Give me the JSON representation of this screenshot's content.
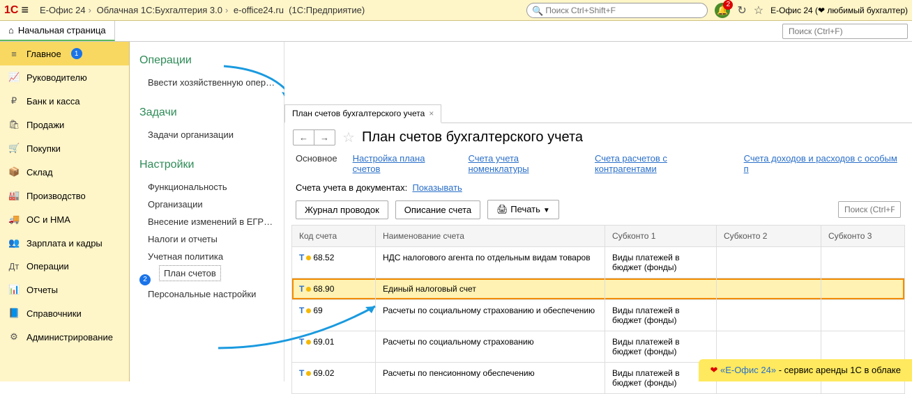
{
  "topbar": {
    "breadcrumb": [
      "Е-Офис 24",
      "Облачная 1С:Бухгалтерия 3.0",
      "e-office24.ru",
      "(1С:Предприятие)"
    ],
    "search_placeholder": "Поиск Ctrl+Shift+F",
    "notification_count": "2",
    "brand": "Е-Офис 24 (❤ любимый бухгалтер)"
  },
  "home": {
    "label": "Начальная страница",
    "search_placeholder": "Поиск (Ctrl+F)"
  },
  "sidebar": {
    "items": [
      {
        "label": "Главное"
      },
      {
        "label": "Руководителю"
      },
      {
        "label": "Банк и касса"
      },
      {
        "label": "Продажи"
      },
      {
        "label": "Покупки"
      },
      {
        "label": "Склад"
      },
      {
        "label": "Производство"
      },
      {
        "label": "ОС и НМА"
      },
      {
        "label": "Зарплата и кадры"
      },
      {
        "label": "Операции"
      },
      {
        "label": "Отчеты"
      },
      {
        "label": "Справочники"
      },
      {
        "label": "Администрирование"
      }
    ],
    "badge_main": "1"
  },
  "subpanel": {
    "sections": [
      {
        "head": "Операции",
        "items": [
          "Ввести хозяйственную операцию"
        ]
      },
      {
        "head": "Задачи",
        "items": [
          "Задачи организации"
        ]
      },
      {
        "head": "Настройки",
        "items": [
          "Функциональность",
          "Организации",
          "Внесение изменений в ЕГРЮЛ",
          "Налоги и отчеты",
          "Учетная политика",
          "План счетов",
          "Персональные настройки"
        ]
      }
    ],
    "marker_2": "2"
  },
  "tab": {
    "label": "План счетов бухгалтерского учета"
  },
  "page": {
    "title": "План счетов бухгалтерского учета",
    "links": {
      "main": "Основное",
      "l1": "Настройка плана счетов",
      "l2": "Счета учета номенклатуры",
      "l3": "Счета расчетов с контрагентами",
      "l4": "Счета доходов и расходов с особым п"
    },
    "subline_pre": "Счета учета в документах:",
    "subline_link": "Показывать",
    "buttons": {
      "journal": "Журнал проводок",
      "desc": "Описание счета",
      "print": "Печать"
    },
    "table_search": "Поиск (Ctrl+F",
    "columns": [
      "Код счета",
      "Наименование счета",
      "Субконто 1",
      "Субконто 2",
      "Субконто 3"
    ],
    "rows": [
      {
        "code": "68.52",
        "name": "НДС налогового агента по отдельным видам товаров",
        "s1": "Виды платежей в бюджет (фонды)"
      },
      {
        "code": "68.90",
        "name": "Единый налоговый счет",
        "s1": "",
        "hl": true
      },
      {
        "code": "69",
        "name": "Расчеты по социальному страхованию и обеспечению",
        "s1": "Виды платежей в бюджет (фонды)"
      },
      {
        "code": "69.01",
        "name": "Расчеты по социальному страхованию",
        "s1": "Виды платежей в бюджет (фонды)"
      },
      {
        "code": "69.02",
        "name": "Расчеты по пенсионному обеспечению",
        "s1": "Виды платежей в бюджет (фонды)"
      }
    ]
  },
  "banner": {
    "text1": "«Е-Офис 24»",
    "text2": " - сервис аренды 1С в облаке"
  }
}
